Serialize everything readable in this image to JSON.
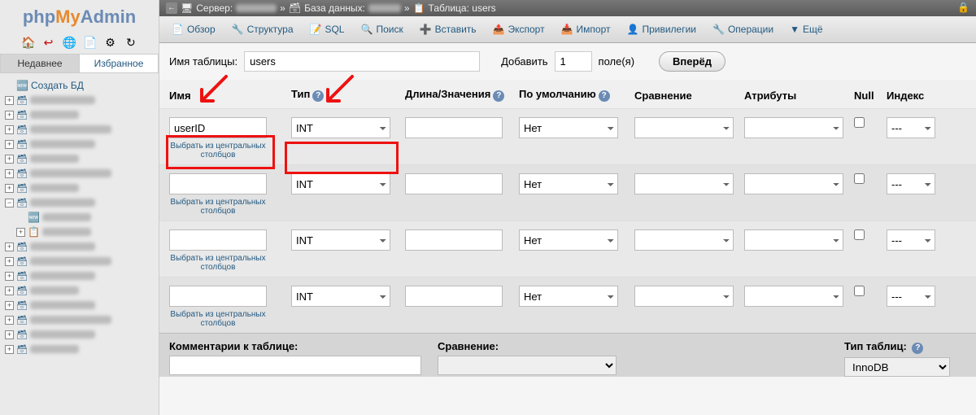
{
  "sidebar": {
    "recent": "Недавнее",
    "favorites": "Избранное",
    "create_db": "Создать БД"
  },
  "topbar": {
    "server_label": "Сервер:",
    "db_label": "База данных:",
    "table_label": "Таблица: users"
  },
  "tabs": {
    "browse": "Обзор",
    "structure": "Структура",
    "sql": "SQL",
    "search": "Поиск",
    "insert": "Вставить",
    "export": "Экспорт",
    "import": "Импорт",
    "privileges": "Привилегии",
    "operations": "Операции",
    "more": "Ещё"
  },
  "form": {
    "table_name_label": "Имя таблицы:",
    "table_name_value": "users",
    "add_label": "Добавить",
    "add_value": "1",
    "fields_label": "поле(я)",
    "go_button": "Вперёд"
  },
  "headers": {
    "name": "Имя",
    "type": "Тип",
    "length": "Длина/Значения",
    "default": "По умолчанию",
    "collation": "Сравнение",
    "attributes": "Атрибуты",
    "null": "Null",
    "index": "Индекс"
  },
  "rows": [
    {
      "name": "userID",
      "type": "INT",
      "default": "Нет"
    },
    {
      "name": "",
      "type": "INT",
      "default": "Нет"
    },
    {
      "name": "",
      "type": "INT",
      "default": "Нет"
    },
    {
      "name": "",
      "type": "INT",
      "default": "Нет"
    }
  ],
  "pick_text": "Выбрать из центральных столбцов",
  "idx_placeholder": "---",
  "footer": {
    "comments": "Комментарии к таблице:",
    "collation": "Сравнение:",
    "storage": "Тип таблиц:",
    "engine": "InnoDB"
  }
}
